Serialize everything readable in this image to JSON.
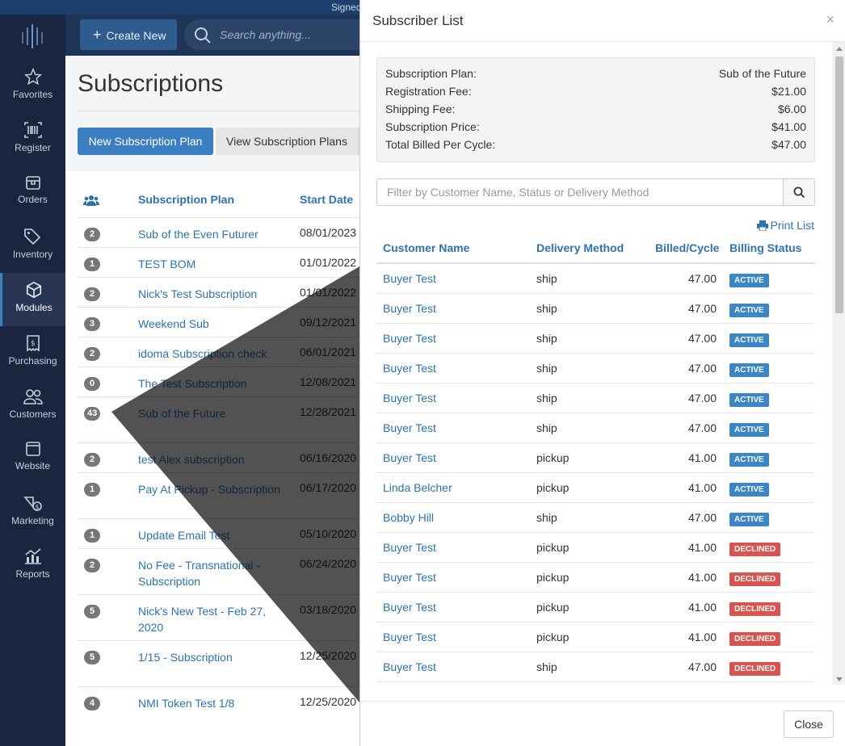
{
  "top_strip": {
    "text": "Signed"
  },
  "sidebar": {
    "items": [
      {
        "label": "Favorites",
        "icon": "star-icon"
      },
      {
        "label": "Register",
        "icon": "barcode-icon"
      },
      {
        "label": "Orders",
        "icon": "box-icon"
      },
      {
        "label": "Inventory",
        "icon": "tags-icon"
      },
      {
        "label": "Modules",
        "icon": "cube-icon",
        "active": true
      },
      {
        "label": "Purchasing",
        "icon": "invoice-icon"
      },
      {
        "label": "Customers",
        "icon": "users-icon"
      },
      {
        "label": "Website",
        "icon": "window-icon"
      },
      {
        "label": "Marketing",
        "icon": "megaphone-icon"
      },
      {
        "label": "Reports",
        "icon": "chart-icon"
      }
    ]
  },
  "header": {
    "create_label": "Create New",
    "search_placeholder": "Search anything..."
  },
  "main": {
    "title": "Subscriptions",
    "new_plan_label": "New Subscription Plan",
    "view_plans_label": "View Subscription Plans",
    "columns": {
      "plan": "Subscription Plan",
      "start": "Start Date"
    },
    "rows": [
      {
        "count": "2",
        "plan": "Sub of the Even Futurer",
        "date": "08/01/2023"
      },
      {
        "count": "1",
        "plan": "TEST BOM",
        "date": "01/01/2022"
      },
      {
        "count": "2",
        "plan": "Nick's Test Subscription",
        "date": "01/01/2022"
      },
      {
        "count": "3",
        "plan": "Weekend Sub",
        "date": "09/12/2021"
      },
      {
        "count": "2",
        "plan": "idoma Subscription check",
        "date": "06/01/2021"
      },
      {
        "count": "0",
        "plan": "The Test Subscription",
        "date": "12/08/2021"
      },
      {
        "count": "43",
        "plan": "Sub of the Future",
        "date": "12/28/2021"
      },
      {
        "count": "2",
        "plan": "test Alex subscription",
        "date": "06/16/2020"
      },
      {
        "count": "1",
        "plan": "Pay At Pickup - Subscription",
        "date": "06/17/2020"
      },
      {
        "count": "1",
        "plan": "Update Email Test",
        "date": "05/10/2020"
      },
      {
        "count": "2",
        "plan": "No Fee - Transnational - Subscription",
        "date": "06/24/2020"
      },
      {
        "count": "5",
        "plan": "Nick's New Test - Feb 27, 2020",
        "date": "03/18/2020"
      },
      {
        "count": "5",
        "plan": "1/15 - Subscription",
        "date": "12/25/2020"
      },
      {
        "count": "4",
        "plan": "NMI Token Test 1/8",
        "date": "12/25/2020"
      }
    ]
  },
  "modal": {
    "title": "Subscriber List",
    "close_x": "×",
    "summary": [
      {
        "label": "Subscription Plan:",
        "value": "Sub of the Future"
      },
      {
        "label": "Registration Fee:",
        "value": "$21.00"
      },
      {
        "label": "Shipping Fee:",
        "value": "$6.00"
      },
      {
        "label": "Subscription Price:",
        "value": "$41.00"
      },
      {
        "label": "Total Billed Per Cycle:",
        "value": "$47.00"
      }
    ],
    "filter_placeholder": "Filter by Customer Name, Status or Delivery Method",
    "print_label": "Print List",
    "columns": {
      "name": "Customer Name",
      "delivery": "Delivery Method",
      "billed": "Billed/Cycle",
      "status": "Billing Status"
    },
    "subscribers": [
      {
        "name": "Buyer Test",
        "delivery": "ship",
        "billed": "47.00",
        "status": "ACTIVE"
      },
      {
        "name": "Buyer Test",
        "delivery": "ship",
        "billed": "47.00",
        "status": "ACTIVE"
      },
      {
        "name": "Buyer Test",
        "delivery": "ship",
        "billed": "47.00",
        "status": "ACTIVE"
      },
      {
        "name": "Buyer Test",
        "delivery": "ship",
        "billed": "47.00",
        "status": "ACTIVE"
      },
      {
        "name": "Buyer Test",
        "delivery": "ship",
        "billed": "47.00",
        "status": "ACTIVE"
      },
      {
        "name": "Buyer Test",
        "delivery": "ship",
        "billed": "47.00",
        "status": "ACTIVE"
      },
      {
        "name": "Buyer Test",
        "delivery": "pickup",
        "billed": "41.00",
        "status": "ACTIVE"
      },
      {
        "name": "Linda Belcher",
        "delivery": "pickup",
        "billed": "41.00",
        "status": "ACTIVE"
      },
      {
        "name": "Bobby Hill",
        "delivery": "ship",
        "billed": "47.00",
        "status": "ACTIVE"
      },
      {
        "name": "Buyer Test",
        "delivery": "pickup",
        "billed": "41.00",
        "status": "DECLINED"
      },
      {
        "name": "Buyer Test",
        "delivery": "pickup",
        "billed": "41.00",
        "status": "DECLINED"
      },
      {
        "name": "Buyer Test",
        "delivery": "pickup",
        "billed": "41.00",
        "status": "DECLINED"
      },
      {
        "name": "Buyer Test",
        "delivery": "pickup",
        "billed": "41.00",
        "status": "DECLINED"
      },
      {
        "name": "Buyer Test",
        "delivery": "ship",
        "billed": "47.00",
        "status": "DECLINED"
      }
    ],
    "close_label": "Close"
  },
  "colors": {
    "accent": "#2d73b4",
    "sidebar": "#1a2640",
    "active": "#3a86c8",
    "declined": "#d9534f"
  }
}
